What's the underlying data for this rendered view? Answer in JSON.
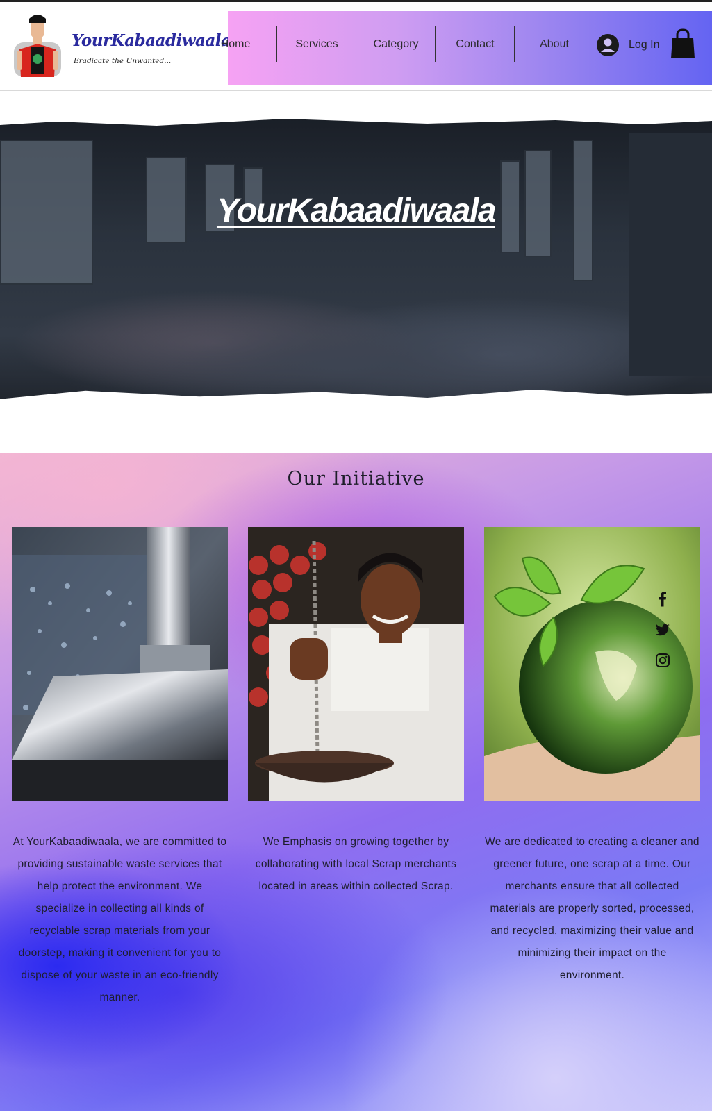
{
  "brand": {
    "name": "YourKabaadiwaala",
    "tagline": "Eradicate the Unwanted..."
  },
  "nav": {
    "items": [
      {
        "label": "Home"
      },
      {
        "label": "Services"
      },
      {
        "label": "Category"
      },
      {
        "label": "Contact"
      },
      {
        "label": "About"
      }
    ],
    "login_label": "Log In",
    "icons": [
      "avatar-icon",
      "shopping-bag-icon"
    ]
  },
  "hero": {
    "title": "YourKabaadiwaala"
  },
  "initiative": {
    "title": "Our Initiative",
    "cards": [
      {
        "image": "metal-scrap-photo",
        "text": "At YourKabaadiwaala, we are committed to providing sustainable waste services that help protect the environment. We specialize in collecting all kinds of recyclable scrap materials from your doorstep, making it convenient for you to dispose of your waste in an eco-friendly manner."
      },
      {
        "image": "scrap-merchant-photo",
        "text": "We Emphasis on growing together by collaborating with local Scrap merchants located in areas within collected Scrap."
      },
      {
        "image": "green-earth-photo",
        "text": "We are dedicated to creating a cleaner and greener future, one scrap at a time. Our merchants ensure that all collected materials are properly sorted, processed, and recycled, maximizing their value and minimizing their impact on the environment."
      }
    ]
  },
  "social": {
    "icons": [
      "facebook-icon",
      "twitter-icon",
      "instagram-icon"
    ]
  },
  "colors": {
    "brand_blue": "#2a2a9e",
    "nav_gradient_start": "#f6a2f3",
    "nav_gradient_end": "#6464f2"
  }
}
